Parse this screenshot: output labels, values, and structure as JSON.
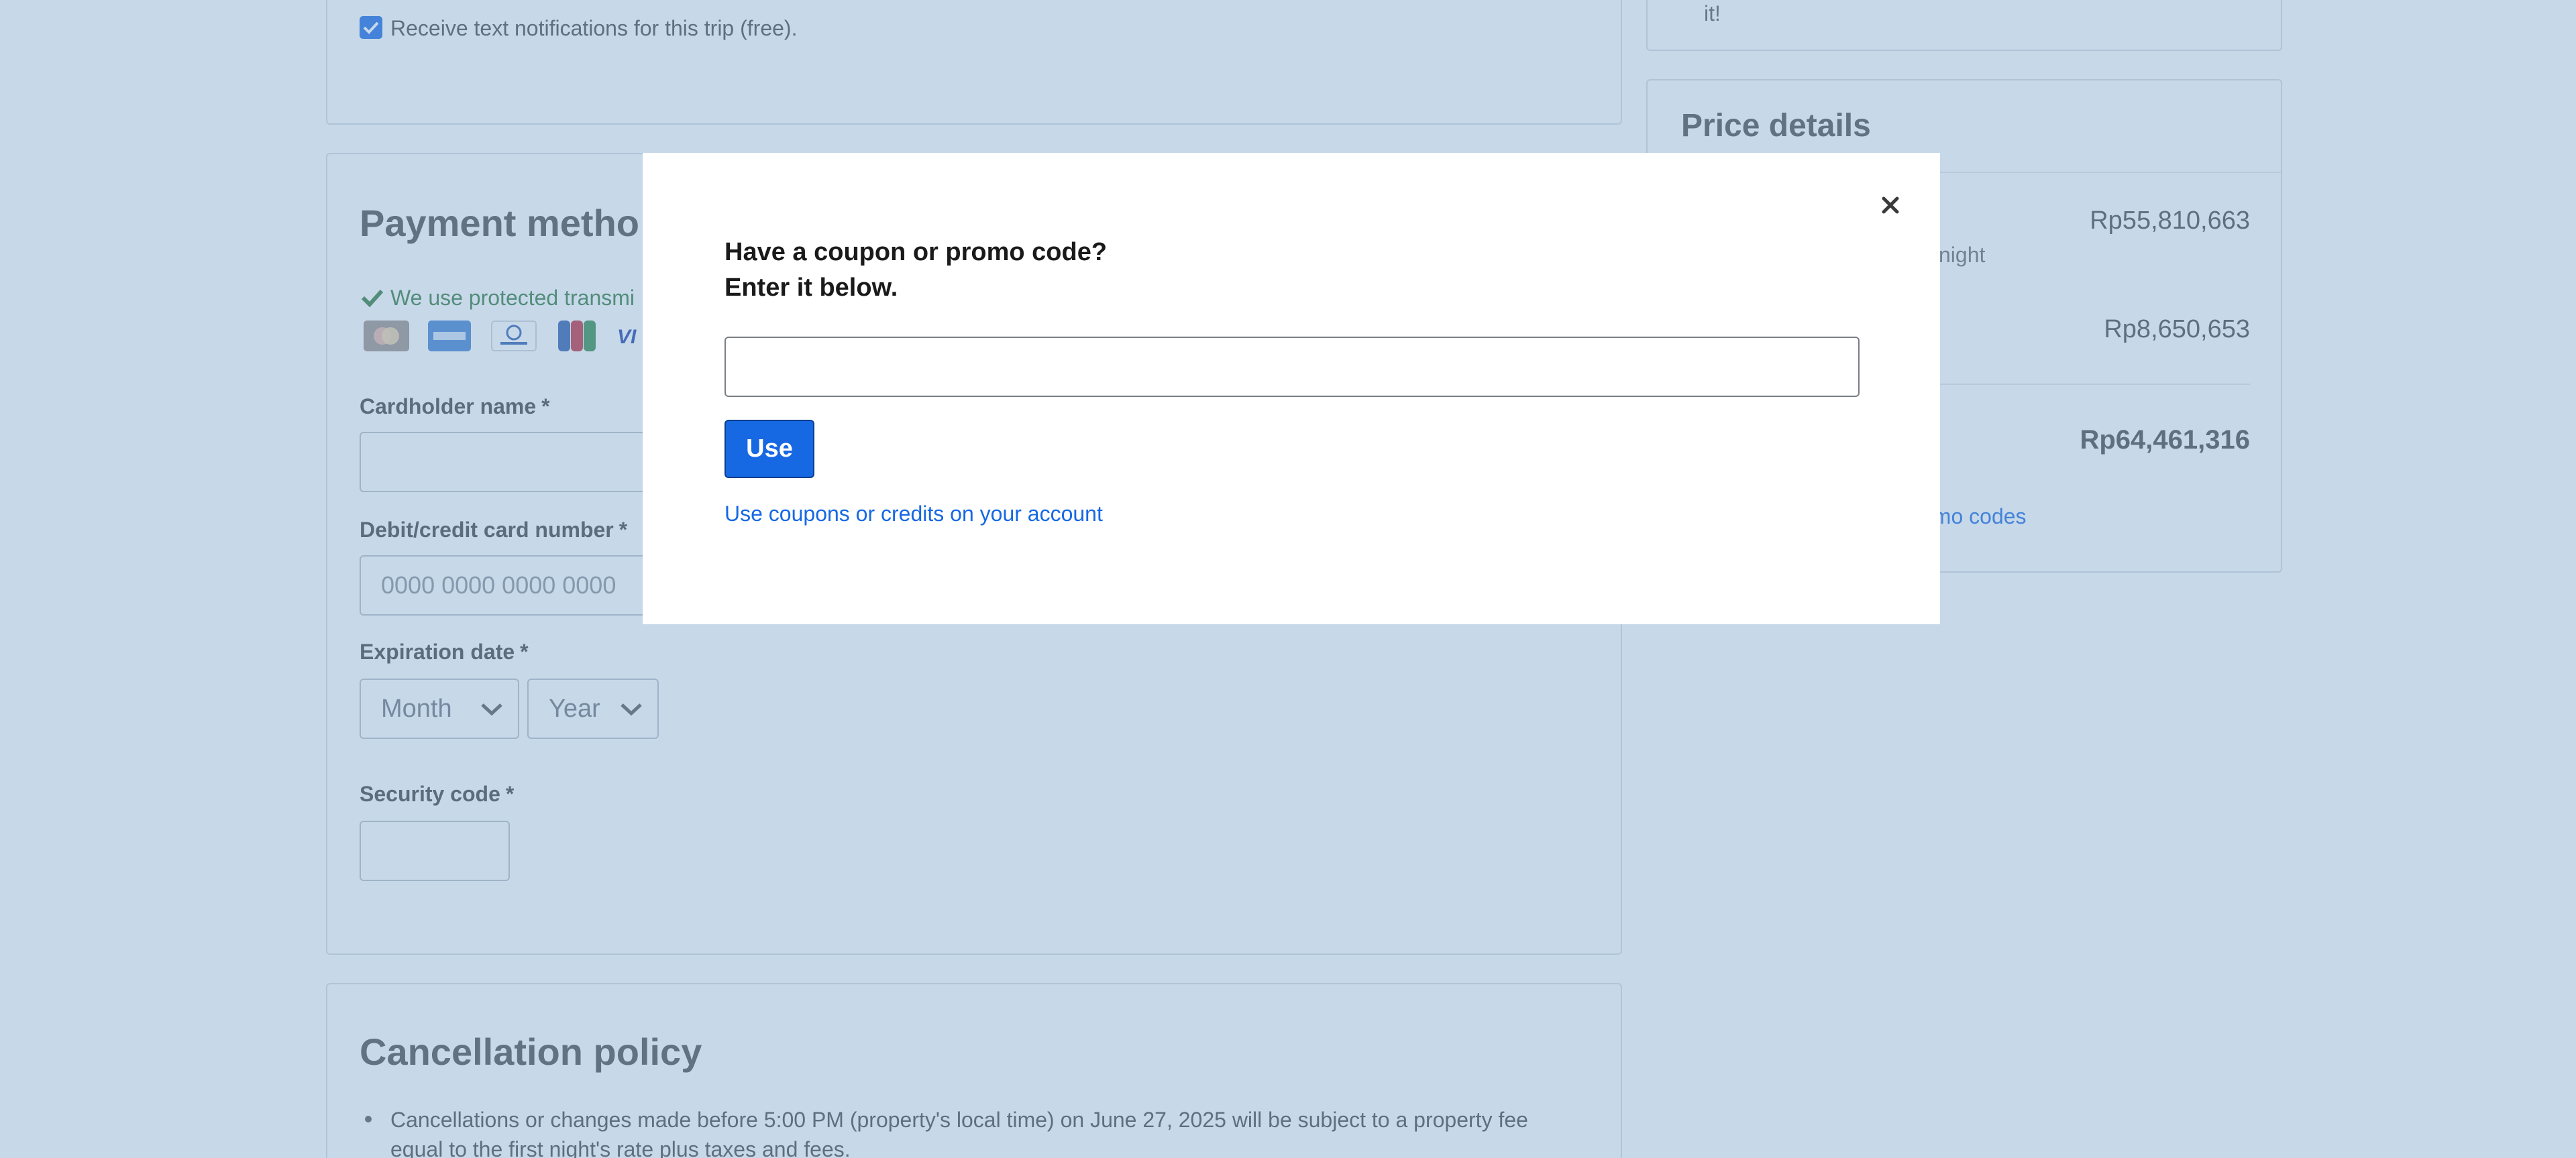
{
  "background": {
    "contact": {
      "sms_checkbox_label": "Receive text notifications for this trip (free)."
    },
    "price_details": {
      "partial_top_text": "it!",
      "title": "Price details",
      "rows": [
        {
          "amount": "Rp55,810,663",
          "sub_fragment": "night"
        },
        {
          "amount": "Rp8,650,653"
        }
      ],
      "total_amount": "Rp64,461,316",
      "promo_link_fragment": "omo codes"
    },
    "payment": {
      "title_fragment": "Payment metho",
      "security_note_fragment": "We use protected transmi",
      "card_icons": [
        "mastercard-icon",
        "amex-icon",
        "diners-icon",
        "jcb-icon",
        "visa-icon"
      ],
      "cardholder_label": "Cardholder name",
      "card_number_label": "Debit/credit card number",
      "card_number_placeholder": "0000 0000 0000 0000",
      "expiration_label": "Expiration date",
      "month_placeholder": "Month",
      "year_placeholder": "Year",
      "security_code_label": "Security code",
      "required_mark": "*"
    },
    "cancellation": {
      "title": "Cancellation policy",
      "line_1": "Cancellations or changes made before 5:00 PM (property's local time) on June 27, 2025 will be subject to a property fee",
      "line_2": "equal to the first night's rate plus taxes and fees."
    }
  },
  "modal": {
    "heading_line_1": "Have a coupon or promo code?",
    "heading_line_2": "Enter it below.",
    "input_value": "",
    "use_button_label": "Use",
    "account_link": "Use coupons or credits on your account",
    "close_icon": "close-icon"
  },
  "colors": {
    "accent": "#1668e3",
    "overlay": "#80a7cc",
    "button_border": "#0a3f8f"
  }
}
